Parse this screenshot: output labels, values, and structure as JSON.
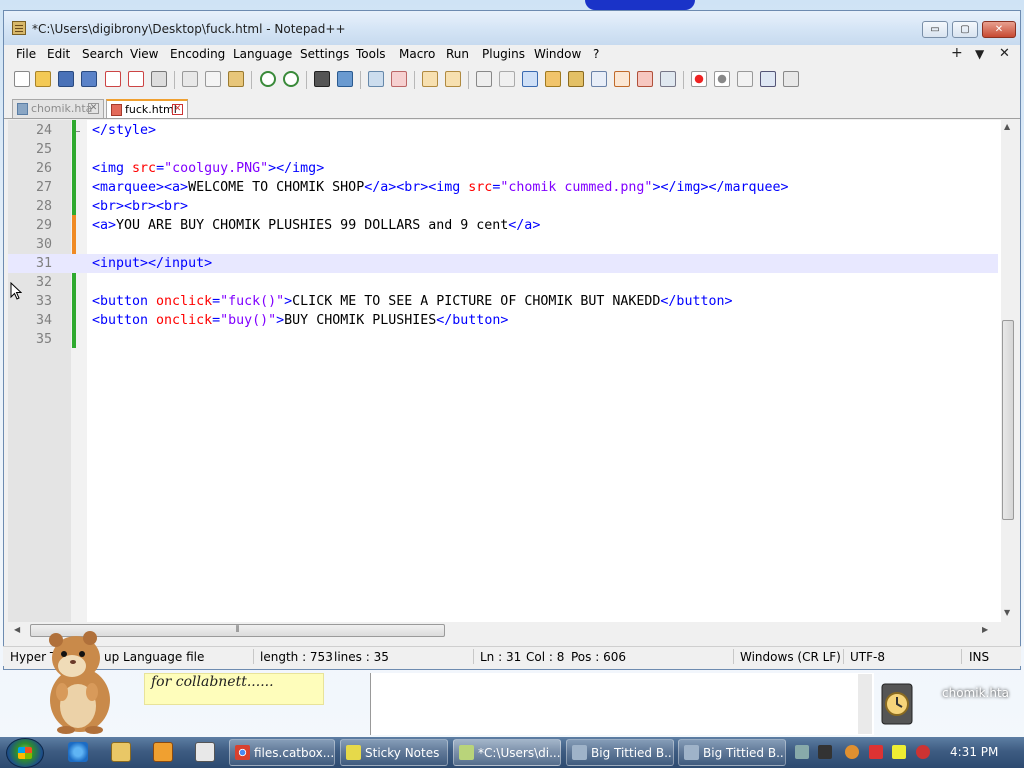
{
  "window": {
    "title": "*C:\\Users\\digibrony\\Desktop\\fuck.html - Notepad++",
    "minimize_label": "▭",
    "maximize_label": "▢",
    "close_label": "✕"
  },
  "menu": {
    "items": [
      "File",
      "Edit",
      "Search",
      "View",
      "Encoding",
      "Language",
      "Settings",
      "Tools",
      "Macro",
      "Run",
      "Plugins",
      "Window",
      "?"
    ],
    "right": [
      "+",
      "▼",
      "✕"
    ]
  },
  "tabs": [
    {
      "label": "chomik.hta",
      "close": "✕",
      "active": false
    },
    {
      "label": "fuck.html",
      "close": "✕",
      "active": true
    }
  ],
  "editor": {
    "current_line": 31,
    "lines": [
      {
        "num": "24",
        "tokens": [
          {
            "t": "tag",
            "v": "</style>"
          }
        ]
      },
      {
        "num": "25",
        "tokens": []
      },
      {
        "num": "26",
        "tokens": [
          {
            "t": "tag",
            "v": "<img "
          },
          {
            "t": "attr",
            "v": "src"
          },
          {
            "t": "tag",
            "v": "="
          },
          {
            "t": "str",
            "v": "\"coolguy.PNG\""
          },
          {
            "t": "tag",
            "v": "></img>"
          }
        ]
      },
      {
        "num": "27",
        "tokens": [
          {
            "t": "tag",
            "v": "<marquee><a>"
          },
          {
            "t": "txt",
            "v": "WELCOME TO CHOMIK SHOP"
          },
          {
            "t": "tag",
            "v": "</a><br><img "
          },
          {
            "t": "attr",
            "v": "src"
          },
          {
            "t": "tag",
            "v": "="
          },
          {
            "t": "str",
            "v": "\"chomik cummed.png\""
          },
          {
            "t": "tag",
            "v": "></img></marquee>"
          }
        ]
      },
      {
        "num": "28",
        "tokens": [
          {
            "t": "tag",
            "v": "<br><br><br>"
          }
        ]
      },
      {
        "num": "29",
        "tokens": [
          {
            "t": "tag",
            "v": "<a>"
          },
          {
            "t": "txt",
            "v": "YOU ARE BUY CHOMIK PLUSHIES 99 DOLLARS and 9 cent"
          },
          {
            "t": "tag",
            "v": "</a>"
          }
        ]
      },
      {
        "num": "30",
        "tokens": []
      },
      {
        "num": "31",
        "tokens": [
          {
            "t": "tag",
            "v": "<input></input>"
          }
        ]
      },
      {
        "num": "32",
        "tokens": []
      },
      {
        "num": "33",
        "tokens": [
          {
            "t": "tag",
            "v": "<button "
          },
          {
            "t": "attr",
            "v": "onclick"
          },
          {
            "t": "tag",
            "v": "="
          },
          {
            "t": "str",
            "v": "\"fuck()\""
          },
          {
            "t": "tag",
            "v": ">"
          },
          {
            "t": "txt",
            "v": "CLICK ME TO SEE A PICTURE OF CHOMIK BUT NAKEDD"
          },
          {
            "t": "tag",
            "v": "</button>"
          }
        ]
      },
      {
        "num": "34",
        "tokens": [
          {
            "t": "tag",
            "v": "<button "
          },
          {
            "t": "attr",
            "v": "onclick"
          },
          {
            "t": "tag",
            "v": "="
          },
          {
            "t": "str",
            "v": "\"buy()\""
          },
          {
            "t": "tag",
            "v": ">"
          },
          {
            "t": "txt",
            "v": "BUY CHOMIK PLUSHIES"
          },
          {
            "t": "tag",
            "v": "</button>"
          }
        ]
      },
      {
        "num": "35",
        "tokens": []
      }
    ]
  },
  "status": {
    "language": "Hyper T",
    "language_tail": "up Language file",
    "length": "length : 753",
    "lines": "lines : 35",
    "ln": "Ln : 31",
    "col": "Col : 8",
    "pos": "Pos : 606",
    "eol": "Windows (CR LF)",
    "encoding": "UTF-8",
    "mode": "INS"
  },
  "sticky_note": {
    "text": "for collabnett......"
  },
  "desktop_icon": {
    "label": "chomik.hta"
  },
  "taskbar": {
    "tasks": [
      {
        "label": "files.catbox....",
        "icon": "chrome-icon",
        "color": "#d9412f"
      },
      {
        "label": "Sticky Notes",
        "icon": "sticky-notes-icon",
        "color": "#e6d94a"
      },
      {
        "label": "*C:\\Users\\di...",
        "icon": "notepadpp-icon",
        "color": "#b9d47a"
      },
      {
        "label": "Big Tittied B...",
        "icon": "window-icon",
        "color": "#9fb3c9"
      },
      {
        "label": "Big Tittied B...",
        "icon": "window-icon",
        "color": "#9fb3c9"
      }
    ],
    "clock": "4:31 PM"
  },
  "colors": {
    "tag": "#0000ff",
    "attr": "#ff0000",
    "string": "#8000ff",
    "current_line": "#e8e8ff",
    "change_saved": "#2faa2f",
    "change_modified": "#f08a24"
  }
}
